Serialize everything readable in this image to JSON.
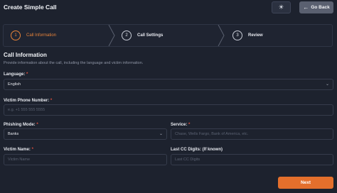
{
  "header": {
    "title": "Create Simple Call",
    "theme_icon": "sun-icon",
    "back_label": "Go Back",
    "back_icon": "arrow-left-icon"
  },
  "stepper": {
    "steps": [
      {
        "number": "1",
        "label": "Call Information",
        "active": true
      },
      {
        "number": "2",
        "label": "Call Settings",
        "active": false
      },
      {
        "number": "3",
        "label": "Review",
        "active": false
      }
    ],
    "active_color": "#e8843a"
  },
  "section": {
    "title": "Call Information",
    "subtitle": "Provide information about the call, including the language and victim information."
  },
  "form": {
    "language": {
      "label": "Language:",
      "required": "*",
      "value": "English"
    },
    "phone": {
      "label": "Victim Phone Number:",
      "required": "*",
      "placeholder": "e.g. +1 555 555 5555"
    },
    "phishing_mode": {
      "label": "Phishing Mode:",
      "required": "*",
      "value": "Banks"
    },
    "service": {
      "label": "Service:",
      "required": "*",
      "placeholder": "Chase, Wells Fargo, Bank of America, etc."
    },
    "victim_name": {
      "label": "Victim Name:",
      "required": "*",
      "placeholder": "Victim Name"
    },
    "last_cc": {
      "label": "Last CC Digits: (If known)",
      "placeholder": "Last CC Digits"
    }
  },
  "footer": {
    "next_label": "Next",
    "next_color": "#e46f2c"
  }
}
